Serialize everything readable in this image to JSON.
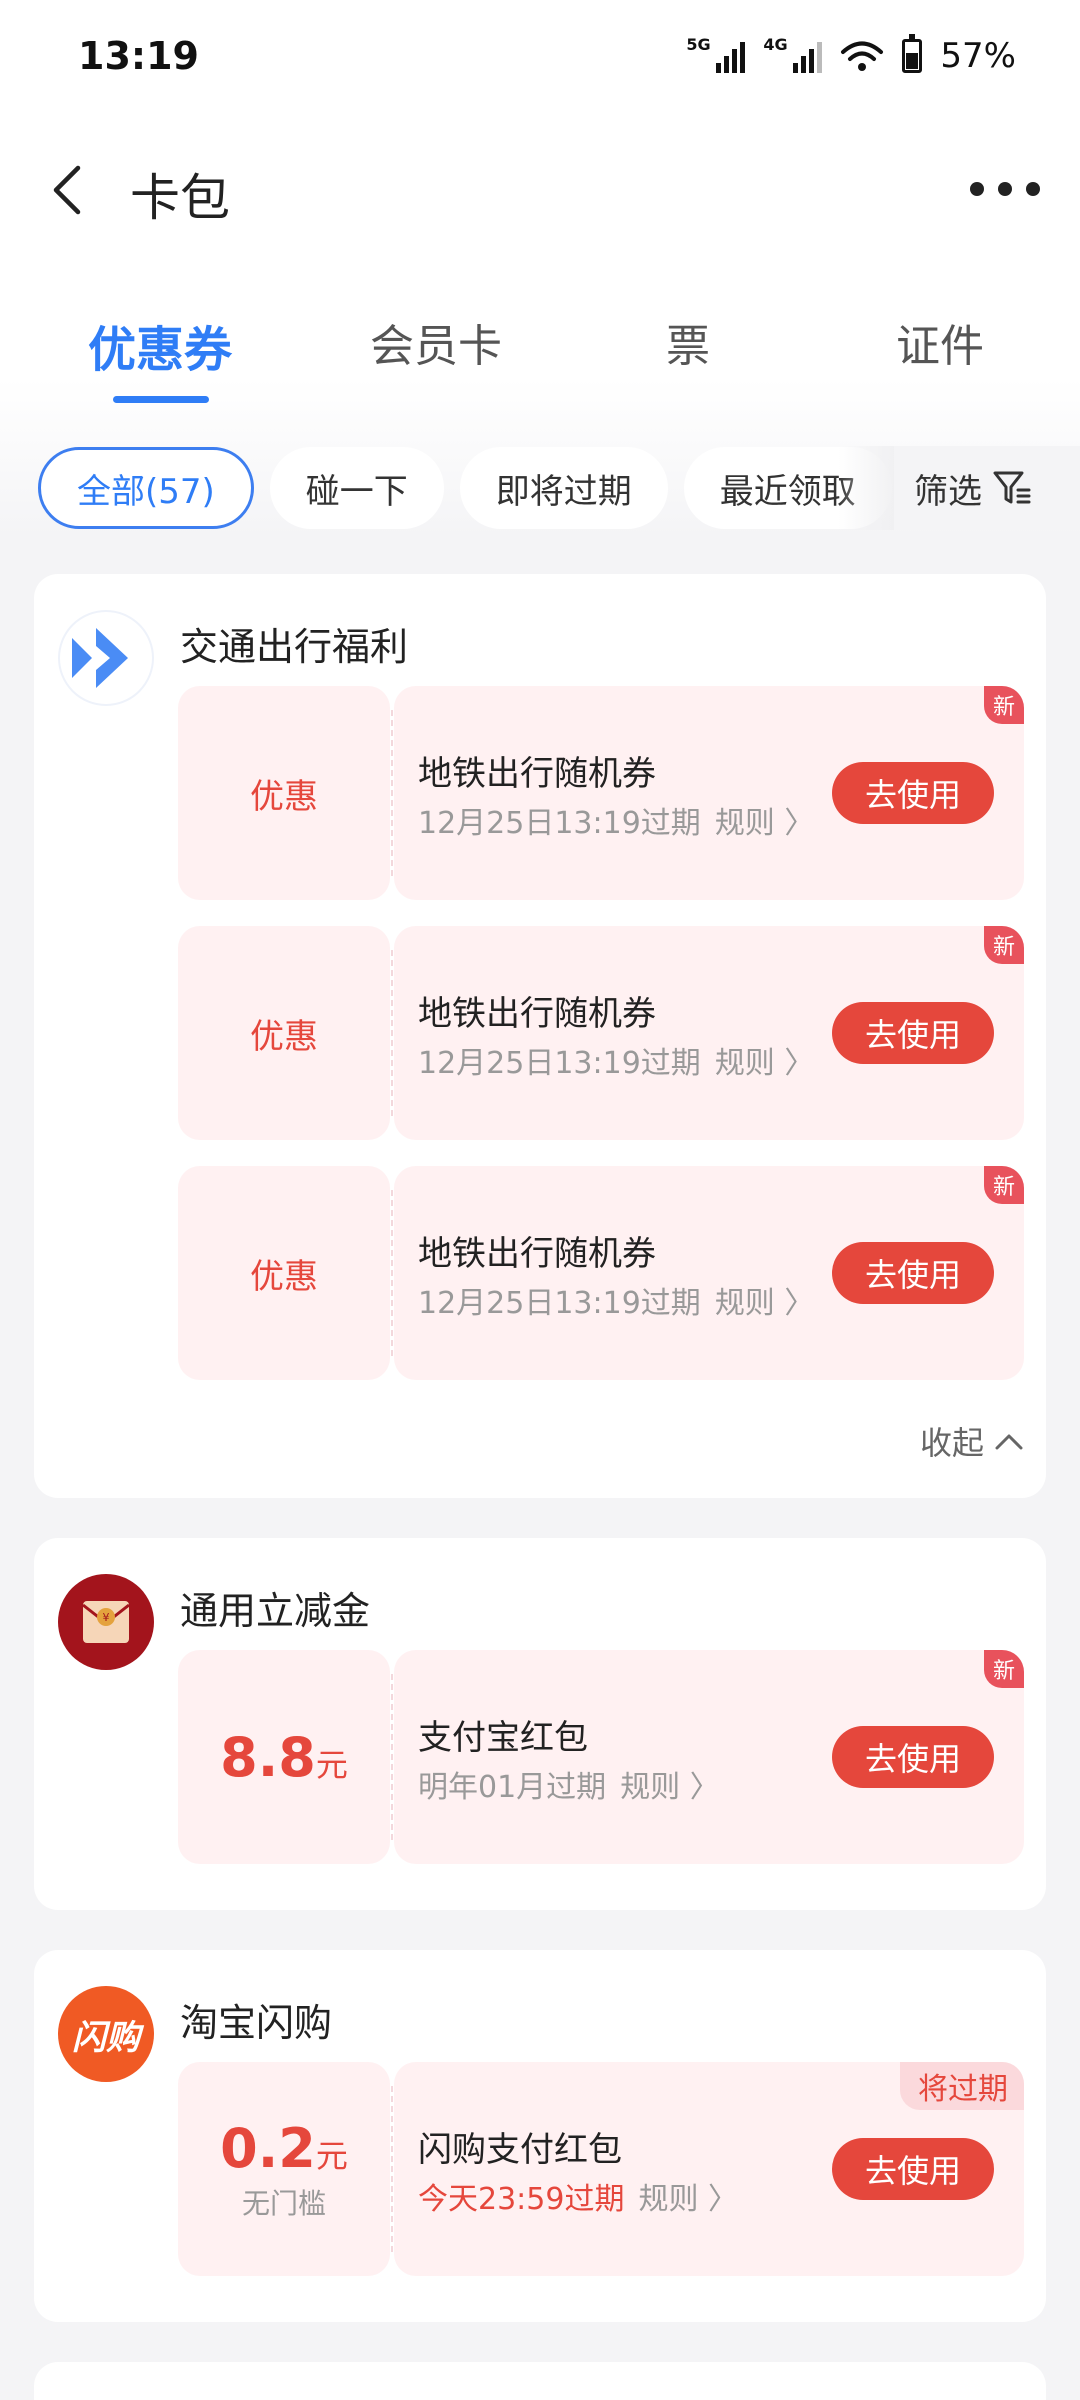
{
  "status_bar": {
    "time": "13:19",
    "sig1": "5G",
    "sig2": "4G",
    "battery": "57%",
    "battery_level": 0.57
  },
  "nav": {
    "title": "卡包"
  },
  "tabs": [
    {
      "label": "优惠券",
      "active": true
    },
    {
      "label": "会员卡",
      "active": false
    },
    {
      "label": "票",
      "active": false
    },
    {
      "label": "证件",
      "active": false
    }
  ],
  "chips": [
    {
      "label": "全部(57)",
      "active": true
    },
    {
      "label": "碰一下",
      "active": false
    },
    {
      "label": "即将过期",
      "active": false
    },
    {
      "label": "最近领取",
      "active": false
    }
  ],
  "filter_label": "筛选",
  "groups": [
    {
      "title": "交通出行福利",
      "icon": "double-chevron-logo",
      "collapse_label": "收起",
      "coupons": [
        {
          "left_label": "优惠",
          "name": "地铁出行随机券",
          "expire": "12月25日13:19过期",
          "rule": "规则",
          "button": "去使用",
          "badge": "新"
        },
        {
          "left_label": "优惠",
          "name": "地铁出行随机券",
          "expire": "12月25日13:19过期",
          "rule": "规则",
          "button": "去使用",
          "badge": "新"
        },
        {
          "left_label": "优惠",
          "name": "地铁出行随机券",
          "expire": "12月25日13:19过期",
          "rule": "规则",
          "button": "去使用",
          "badge": "新"
        }
      ]
    },
    {
      "title": "通用立减金",
      "icon": "red-envelope-logo",
      "coupons": [
        {
          "amount": "8.8",
          "unit": "元",
          "name": "支付宝红包",
          "expire": "明年01月过期",
          "rule": "规则",
          "button": "去使用",
          "badge": "新"
        }
      ]
    },
    {
      "title": "淘宝闪购",
      "icon": "shangou-logo",
      "logo_text": "闪购",
      "coupons": [
        {
          "amount": "0.2",
          "unit": "元",
          "sub": "无门槛",
          "name": "闪购支付红包",
          "expire": "今天23:59过期",
          "rule": "规则",
          "button": "去使用",
          "badge_expiring": "将过期"
        }
      ]
    }
  ],
  "colors": {
    "accent_blue": "#2f7df6",
    "coupon_red": "#e5473c",
    "coupon_bg": "#fff1f2"
  }
}
